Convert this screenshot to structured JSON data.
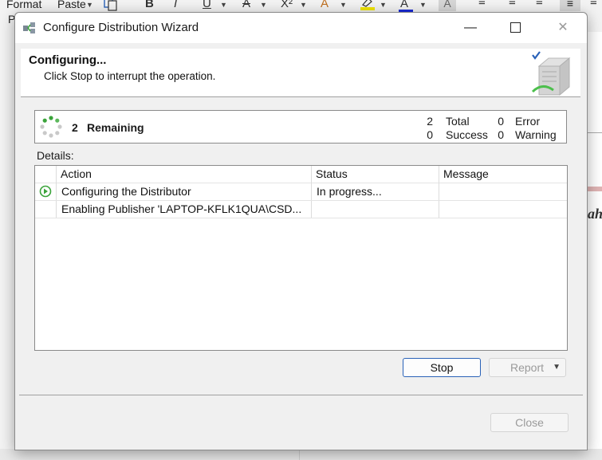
{
  "background_app": {
    "ribbon": {
      "format_label": "Format",
      "paste_label": "Paste",
      "fragment_label": "P"
    }
  },
  "window": {
    "title": "Configure Distribution Wizard",
    "controls": {
      "minimize": "—",
      "close": "✕"
    }
  },
  "header": {
    "title": "Configuring...",
    "subtitle": "Click Stop to interrupt the operation."
  },
  "status": {
    "remaining_count": "2",
    "remaining_label": "Remaining",
    "total_count": "2",
    "total_label": "Total",
    "success_count": "0",
    "success_label": "Success",
    "error_count": "0",
    "error_label": "Error",
    "warning_count": "0",
    "warning_label": "Warning"
  },
  "details": {
    "label": "Details:",
    "columns": [
      "Action",
      "Status",
      "Message"
    ],
    "rows": [
      {
        "icon": "in-progress-icon",
        "action": "Configuring the Distributor",
        "status": "In progress...",
        "message": ""
      },
      {
        "icon": "",
        "action": "Enabling Publisher 'LAPTOP-KFLK1QUA\\CSD...",
        "status": "",
        "message": ""
      }
    ]
  },
  "buttons": {
    "stop": "Stop",
    "report": "Report",
    "close": "Close"
  },
  "colors": {
    "accent": "#2a62b8",
    "progress_green": "#3aa33a"
  }
}
